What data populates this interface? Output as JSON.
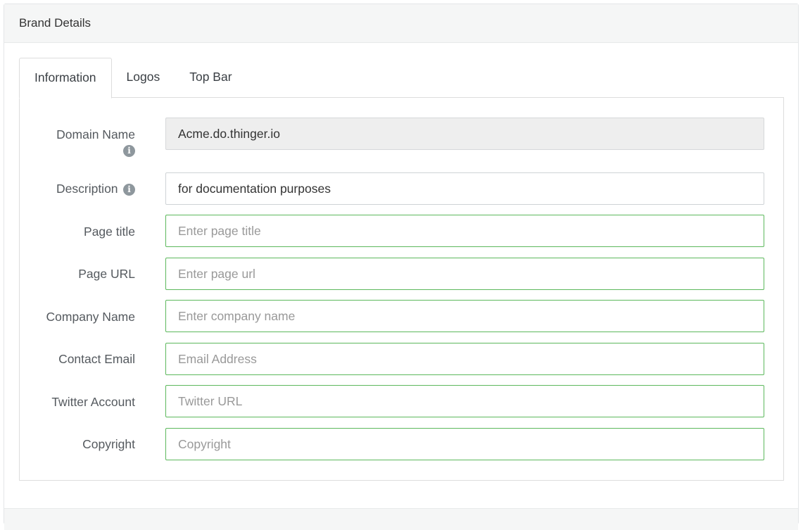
{
  "panel": {
    "title": "Brand Details"
  },
  "tabs": [
    {
      "label": "Information",
      "active": true
    },
    {
      "label": "Logos",
      "active": false
    },
    {
      "label": "Top Bar",
      "active": false
    }
  ],
  "form": {
    "domain_name": {
      "label": "Domain Name",
      "value": "Acme.do.thinger.io",
      "info_icon": "info-icon"
    },
    "description": {
      "label": "Description",
      "value": "for documentation purposes",
      "info_icon": "info-icon"
    },
    "page_title": {
      "label": "Page title",
      "placeholder": "Enter page title"
    },
    "page_url": {
      "label": "Page URL",
      "placeholder": "Enter page url"
    },
    "company_name": {
      "label": "Company Name",
      "placeholder": "Enter company name"
    },
    "contact_email": {
      "label": "Contact Email",
      "placeholder": "Email Address"
    },
    "twitter_account": {
      "label": "Twitter Account",
      "placeholder": "Twitter URL"
    },
    "copyright": {
      "label": "Copyright",
      "placeholder": "Copyright"
    }
  },
  "colors": {
    "valid_border": "#5cb85c",
    "readonly_bg": "#eeeeee",
    "header_bg": "#f5f6f6"
  }
}
